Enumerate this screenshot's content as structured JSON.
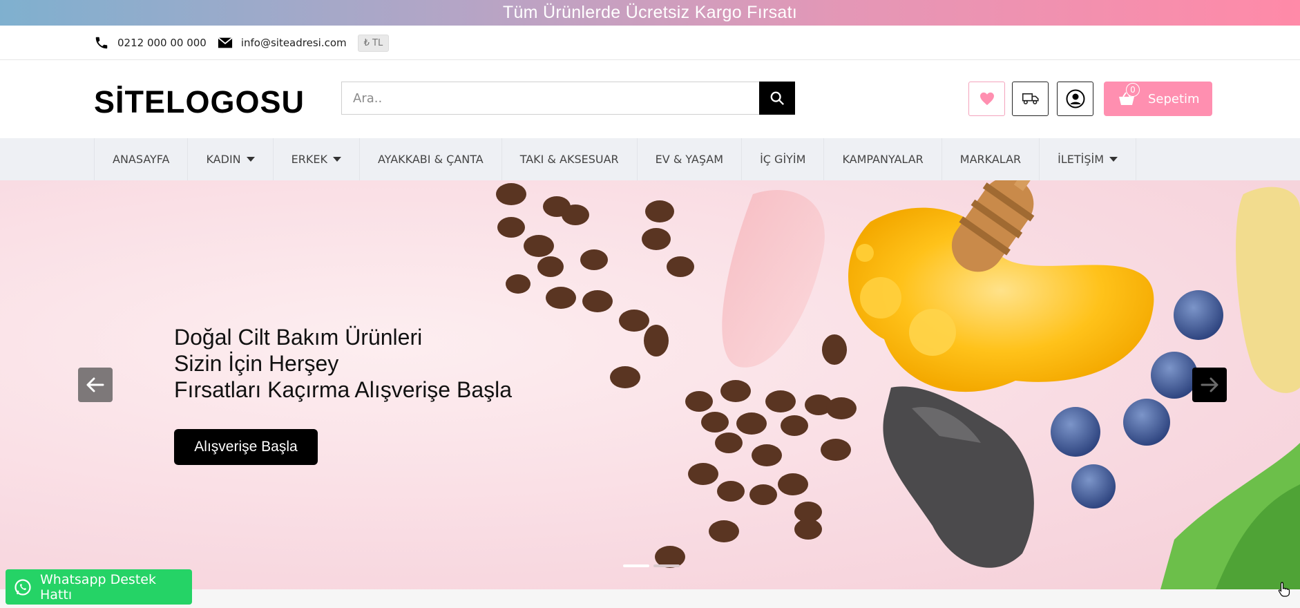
{
  "announcement": {
    "text": "Tüm Ürünlerde Ücretsiz Kargo Fırsatı"
  },
  "topbar": {
    "phone": "0212 000 00 000",
    "email": "info@siteadresi.com",
    "currency": "₺ TL",
    "phone_icon": "phone-icon",
    "email_icon": "envelope-icon"
  },
  "header": {
    "logo": "SİTELOGOSU",
    "search_placeholder": "Ara..",
    "cart_label": "Sepetim",
    "cart_count": "0",
    "icons": [
      "heart-icon",
      "truck-icon",
      "user-icon",
      "basket-icon"
    ]
  },
  "nav": {
    "items": [
      {
        "label": "ANASAYFA",
        "dropdown": false
      },
      {
        "label": "KADIN",
        "dropdown": true
      },
      {
        "label": "ERKEK",
        "dropdown": true
      },
      {
        "label": "AYAKKABI & ÇANTA",
        "dropdown": false
      },
      {
        "label": "TAKI & AKSESUAR",
        "dropdown": false
      },
      {
        "label": "EV & YAŞAM",
        "dropdown": false
      },
      {
        "label": "İÇ GİYİM",
        "dropdown": false
      },
      {
        "label": "KAMPANYALAR",
        "dropdown": false
      },
      {
        "label": "MARKALAR",
        "dropdown": false
      },
      {
        "label": "İLETİŞİM",
        "dropdown": true
      }
    ]
  },
  "hero": {
    "line1": "Doğal Cilt Bakım Ürünleri",
    "line2": "Sizin İçin Herşey",
    "line3": "Fırsatları Kaçırma Alışverişe Başla",
    "cta": "Alışverişe Başla",
    "active_slide": 1,
    "slide_count": 2
  },
  "whatsapp": {
    "label": "Whatsapp Destek Hattı"
  },
  "colors": {
    "accent": "#ff8fb0",
    "whatsapp": "#25d366",
    "nav_bg": "#eef0f4"
  }
}
